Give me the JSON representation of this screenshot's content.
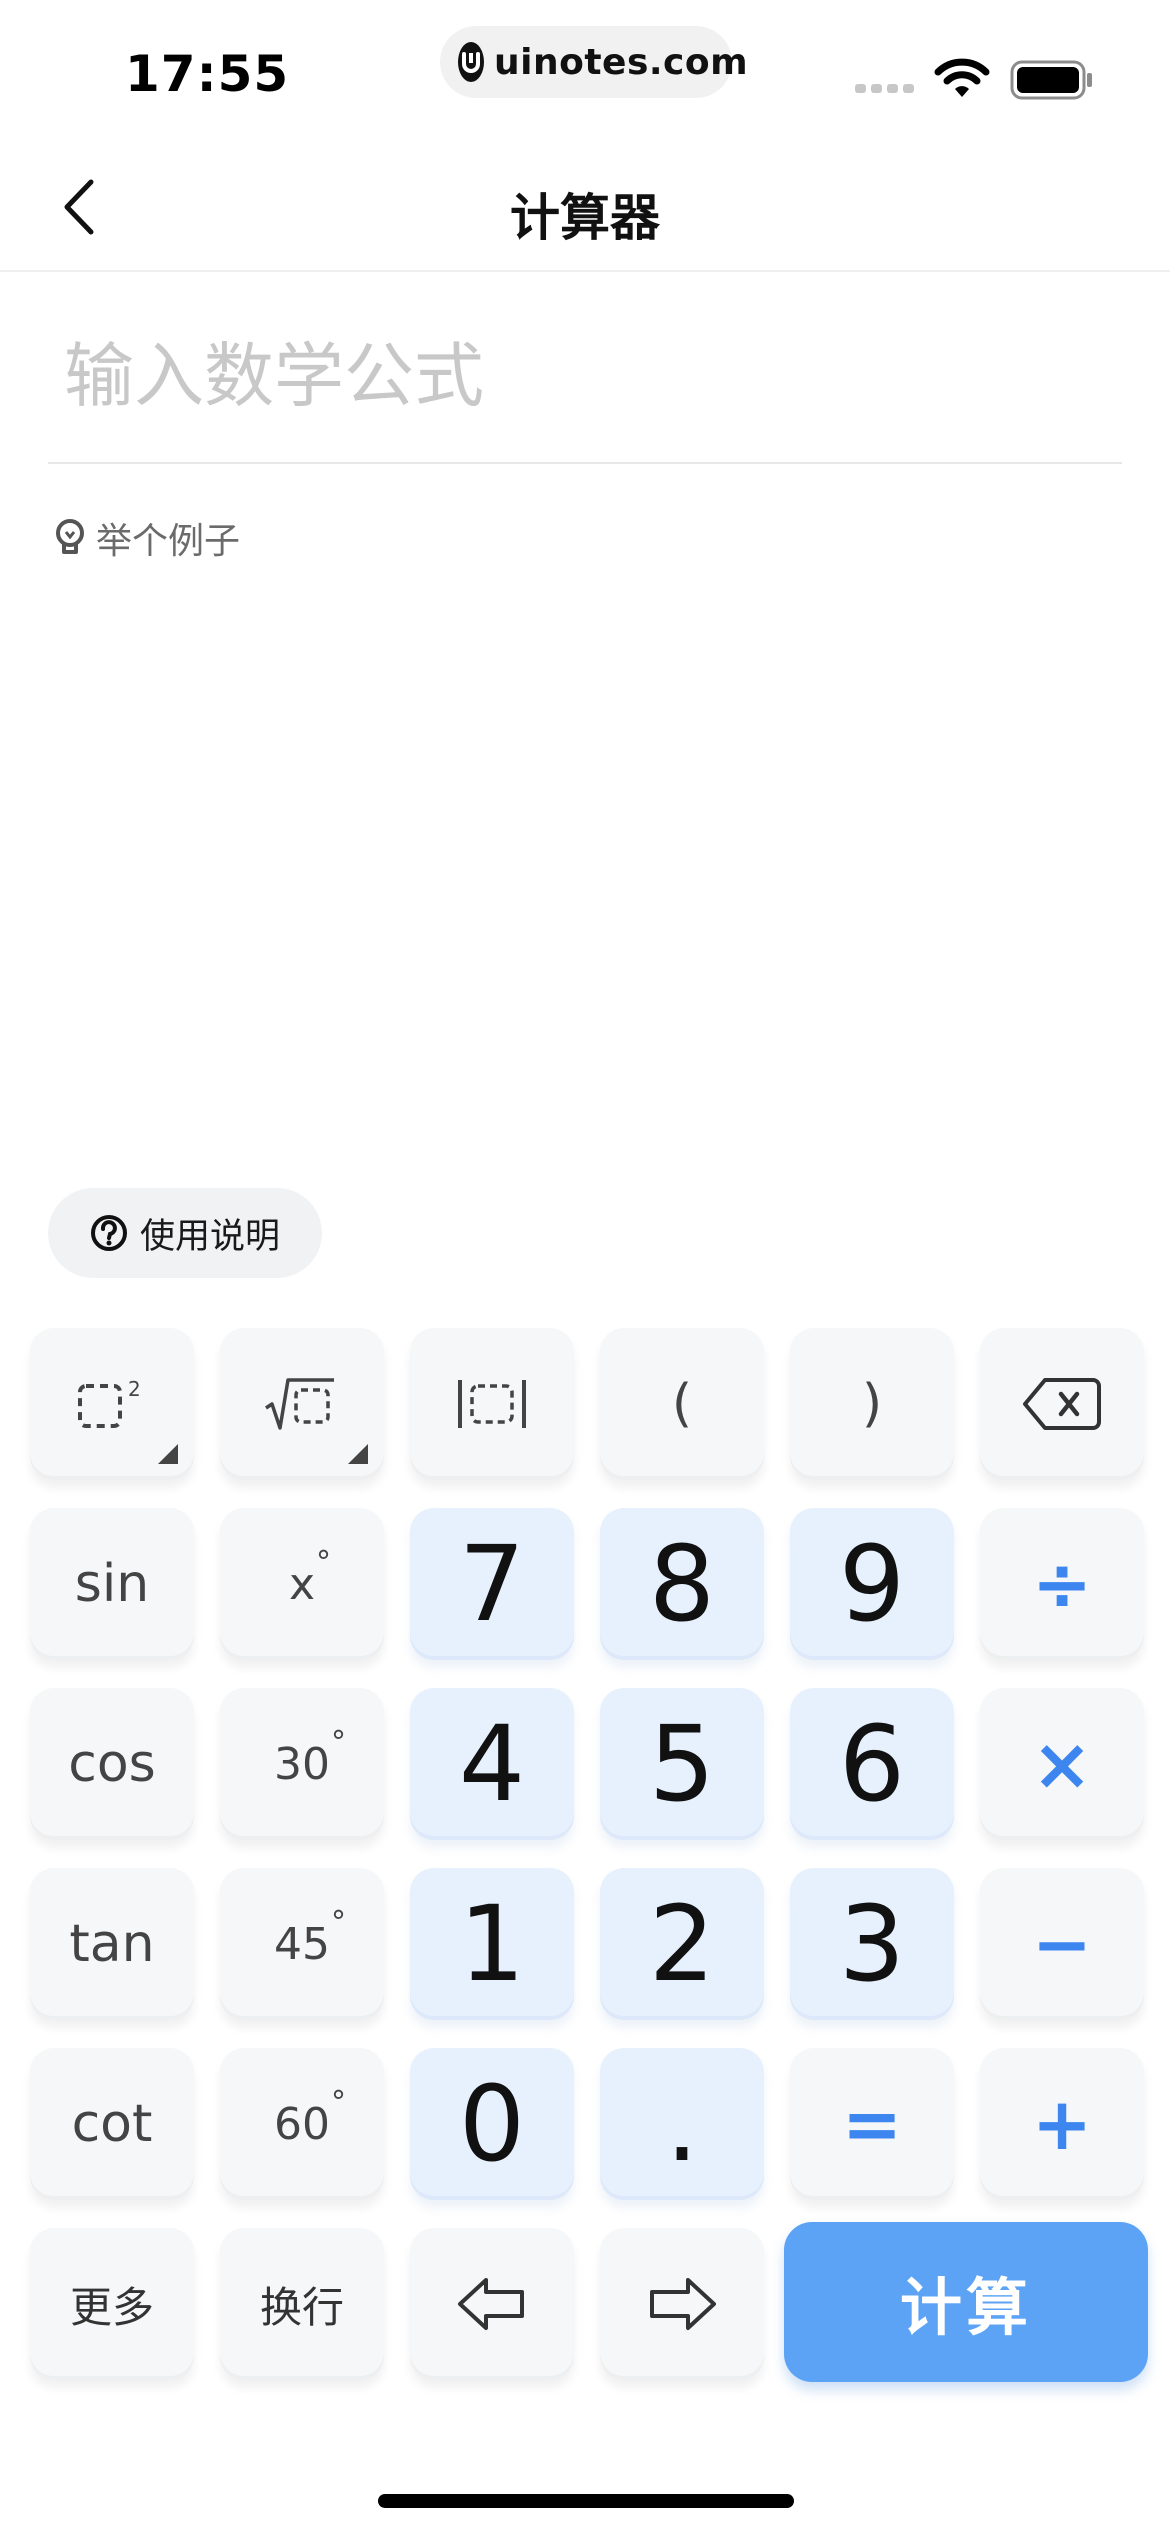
{
  "status_bar": {
    "time": "17:55",
    "url": "uinotes.com",
    "icons": [
      "signal-icon",
      "wifi-icon",
      "battery-icon"
    ]
  },
  "nav": {
    "title": "计算器",
    "back_icon": "chevron-left-icon"
  },
  "formula": {
    "value": "",
    "placeholder": "输入数学公式"
  },
  "example": {
    "label": "举个例子",
    "icon": "lightbulb-icon"
  },
  "help": {
    "label": "使用说明",
    "icon": "question-circle-icon"
  },
  "keypad": {
    "row1": {
      "square_icon": "square-power-icon",
      "sqrt_icon": "square-root-icon",
      "abs_icon": "absolute-value-icon",
      "lparen": "(",
      "rparen": ")",
      "backspace_icon": "backspace-icon"
    },
    "row2": {
      "fn": "sin",
      "deg": "x",
      "n1": "7",
      "n2": "8",
      "n3": "9",
      "op": "÷"
    },
    "row3": {
      "fn": "cos",
      "deg": "30",
      "n1": "4",
      "n2": "5",
      "n3": "6",
      "op": "×"
    },
    "row4": {
      "fn": "tan",
      "deg": "45",
      "n1": "1",
      "n2": "2",
      "n3": "3",
      "op": "−"
    },
    "row5": {
      "fn": "cot",
      "deg": "60",
      "n1": "0",
      "n2": ".",
      "eq": "=",
      "op": "+"
    },
    "row6": {
      "more": "更多",
      "newline": "换行",
      "left_icon": "arrow-left-icon",
      "right_icon": "arrow-right-icon",
      "calc": "计算"
    },
    "degree_symbol": "°"
  },
  "colors": {
    "accent": "#3d86f0",
    "calc_button": "#5da3f5",
    "num_key": "#e7f1fd",
    "fn_key": "#f6f7f8",
    "placeholder": "#c8c8c8"
  }
}
